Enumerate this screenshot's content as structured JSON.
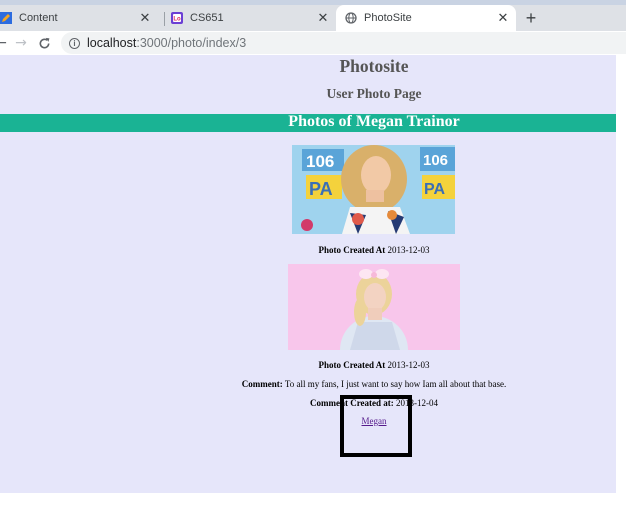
{
  "browser": {
    "tabs": [
      {
        "title": "Content",
        "favicon": "pencil-icon"
      },
      {
        "title": "CS651",
        "favicon": "lo-icon"
      },
      {
        "title": "PhotoSite",
        "favicon": "globe-icon"
      }
    ],
    "new_tab_symbol": "+",
    "close_symbol": "✕",
    "url_host": "localhost",
    "url_path": ":3000/photo/index/3"
  },
  "page": {
    "site_title": "Photosite",
    "subtitle": "User Photo Page",
    "banner": "Photos of Megan Trainor",
    "photos": [
      {
        "created_label": "Photo Created At",
        "created_date": "2013-12-03"
      },
      {
        "created_label": "Photo Created At",
        "created_date": "2013-12-03",
        "comment_label": "Comment:",
        "comment_text": "To all my fans, I just want to say how Iam all about that base.",
        "comment_date_label": "Comment Created at:",
        "comment_date": "2013-12-04",
        "comment_user": "Megan"
      }
    ]
  },
  "colors": {
    "page_background": "#e6e6fa",
    "banner_background": "#1ab394",
    "heading_gray": "#555555",
    "link_visited": "#551a8b"
  }
}
